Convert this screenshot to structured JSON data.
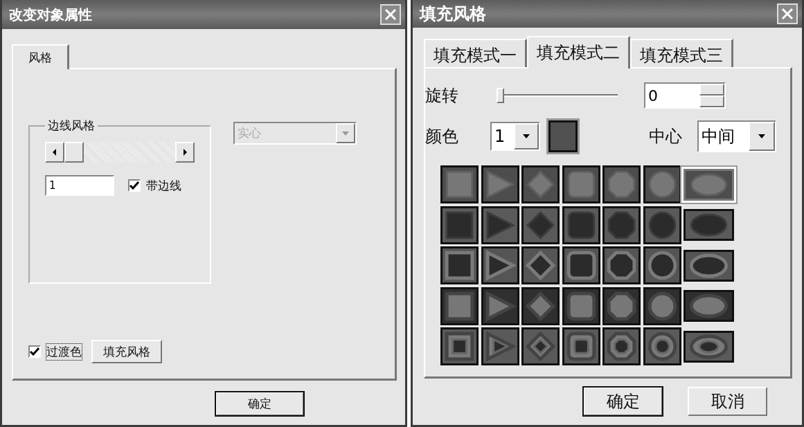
{
  "properties_dialog": {
    "title": "改变对象属性",
    "tabs": [
      {
        "label": "风格",
        "selected": true
      }
    ],
    "border_group": {
      "title": "边线风格",
      "width_value": "1",
      "border_checkbox": {
        "label": "带边线",
        "checked": true
      }
    },
    "line_style_select": {
      "value": "实心",
      "disabled": true
    },
    "gradient_checkbox": {
      "label": "过渡色",
      "checked": true
    },
    "fill_style_button": "填充风格",
    "ok_button": "确定"
  },
  "fill_dialog": {
    "title": "填充风格",
    "tabs": [
      {
        "label": "填充模式一",
        "selected": false
      },
      {
        "label": "填充模式二",
        "selected": true
      },
      {
        "label": "填充模式三",
        "selected": false
      }
    ],
    "rotation": {
      "label": "旋转",
      "level": 0,
      "value": "0"
    },
    "color": {
      "label": "颜色",
      "value": "1"
    },
    "center": {
      "label": "中心",
      "value": "中间"
    },
    "swatches": [
      [
        {
          "selected": false
        },
        {
          "selected": false
        },
        {
          "selected": false
        },
        {
          "selected": false
        },
        {
          "selected": false
        },
        {
          "selected": false
        },
        {
          "selected": true
        }
      ],
      [
        {
          "selected": false
        },
        {
          "selected": false
        },
        {
          "selected": false
        },
        {
          "selected": false
        },
        {
          "selected": false
        },
        {
          "selected": false
        },
        {
          "selected": false
        }
      ],
      [
        {
          "selected": false
        },
        {
          "selected": false
        },
        {
          "selected": false
        },
        {
          "selected": false
        },
        {
          "selected": false
        },
        {
          "selected": false
        },
        {
          "selected": false
        }
      ],
      [
        {
          "selected": false
        },
        {
          "selected": false
        },
        {
          "selected": false
        },
        {
          "selected": false
        },
        {
          "selected": false
        },
        {
          "selected": false
        },
        {
          "selected": false
        }
      ],
      [
        {
          "selected": false
        },
        {
          "selected": false
        },
        {
          "selected": false
        },
        {
          "selected": false
        },
        {
          "selected": false
        },
        {
          "selected": false
        },
        {
          "selected": false
        }
      ]
    ],
    "buttons": [
      "确定",
      "取消"
    ]
  }
}
